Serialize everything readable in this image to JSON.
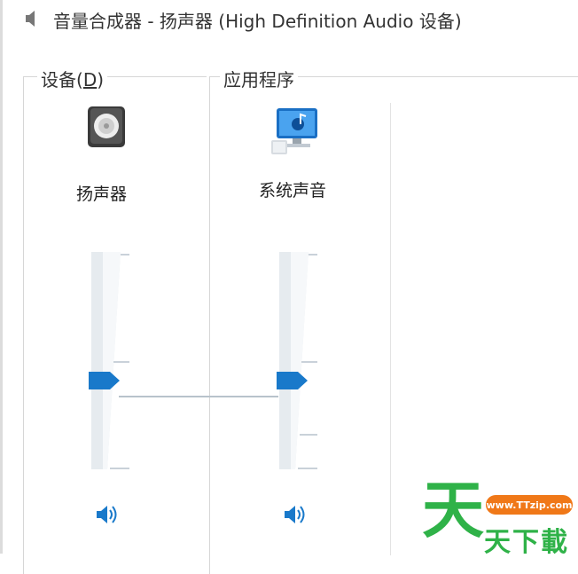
{
  "window": {
    "title": "音量合成器 - 扬声器 (High Definition Audio 设备)",
    "icon": "speaker-icon"
  },
  "device_section": {
    "label": "设备(",
    "accelerator": "D",
    "label_end": ")",
    "device": {
      "name": "扬声器",
      "icon": "speaker-device-icon",
      "volume_fraction": 0.4,
      "mute_icon": "speaker-volume-icon"
    }
  },
  "apps_section": {
    "label": "应用程序",
    "apps": [
      {
        "name": "系统声音",
        "icon": "system-sounds-icon",
        "volume_fraction": 0.4,
        "mute_icon": "speaker-volume-icon"
      }
    ]
  },
  "watermark": {
    "big_char": "天",
    "url": "www.TTzip.com",
    "text": "天下載",
    "color": "#2fb248",
    "badge_color": "#f07818"
  },
  "colors": {
    "accent": "#1979ca",
    "track": "#e6ebef",
    "border": "#d6d6d6"
  }
}
